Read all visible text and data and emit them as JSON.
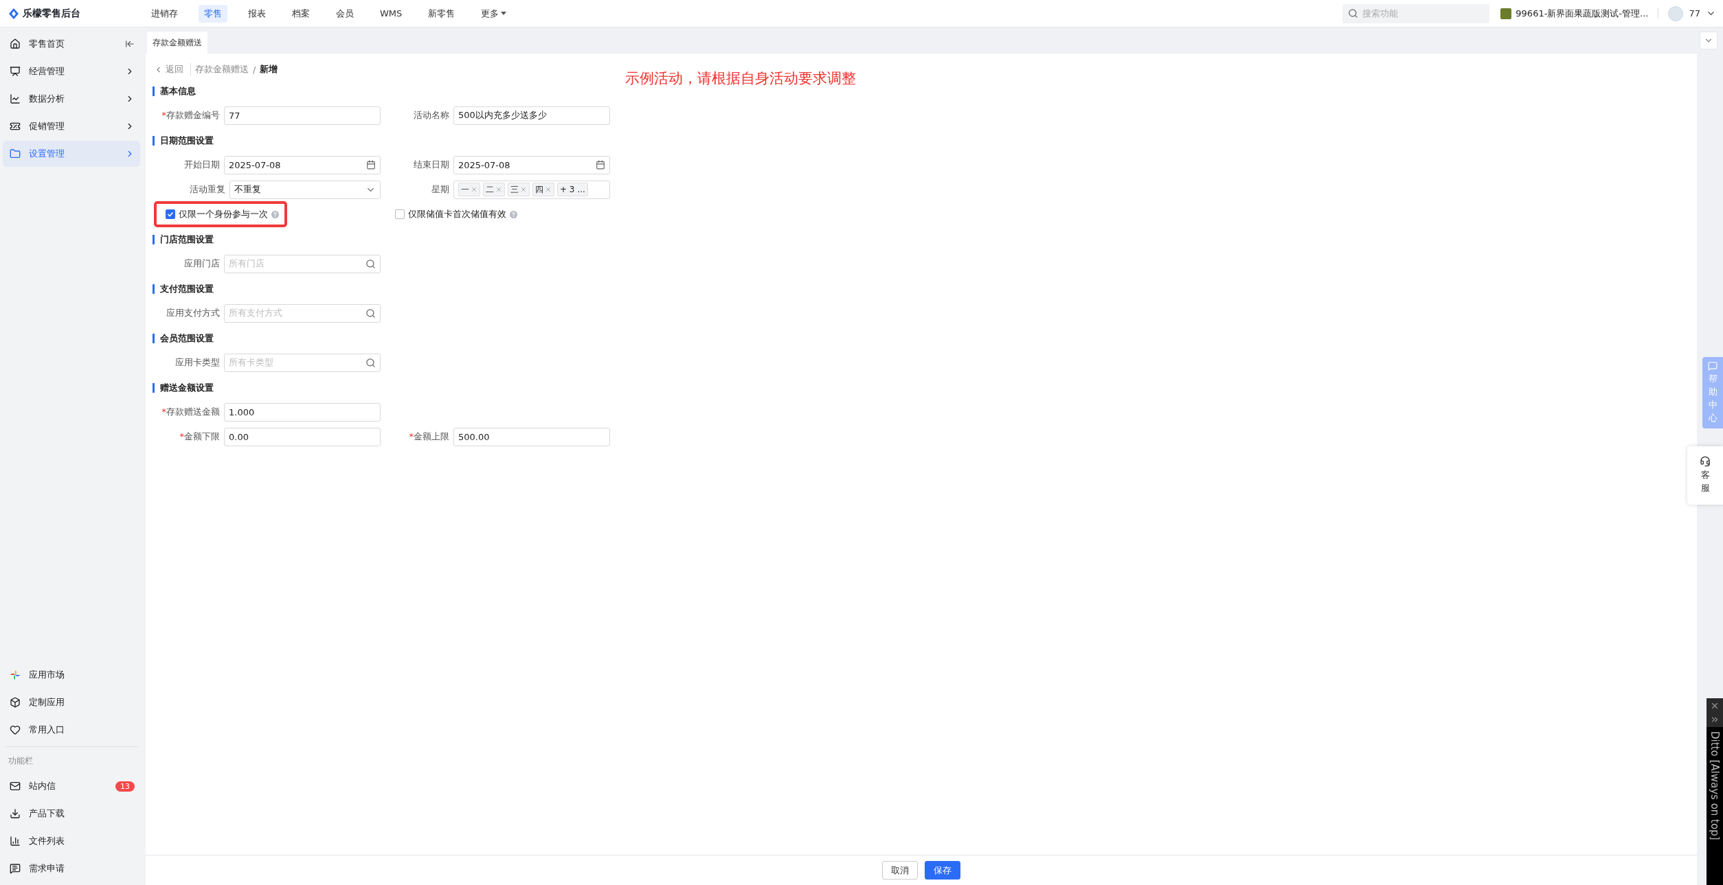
{
  "app": {
    "logo_text": "乐檬零售后台"
  },
  "top_nav": [
    {
      "label": "进销存",
      "selected": false,
      "kind": "link"
    },
    {
      "label": "零售",
      "selected": true,
      "kind": "link"
    },
    {
      "label": "报表",
      "selected": false,
      "kind": "link"
    },
    {
      "label": "档案",
      "selected": false,
      "kind": "link"
    },
    {
      "label": "会员",
      "selected": false,
      "kind": "link"
    },
    {
      "label": "WMS",
      "selected": false,
      "kind": "link"
    },
    {
      "label": "新零售",
      "selected": false,
      "kind": "link"
    },
    {
      "label": "更多",
      "selected": false,
      "kind": "dropdown"
    }
  ],
  "search": {
    "placeholder": "搜索功能"
  },
  "store": {
    "name": "99661-新界面果蔬版测试-管理..."
  },
  "user": {
    "name": "77"
  },
  "sidebar": {
    "items": [
      {
        "label": "零售首页",
        "selected": false
      },
      {
        "label": "经营管理",
        "selected": false
      },
      {
        "label": "数据分析",
        "selected": false
      },
      {
        "label": "促销管理",
        "selected": false
      },
      {
        "label": "设置管理",
        "selected": true
      }
    ],
    "bottom_items": [
      {
        "label": "应用市场"
      },
      {
        "label": "定制应用"
      },
      {
        "label": "常用入口"
      }
    ],
    "section_label": "功能栏",
    "tools": [
      {
        "label": "站内信",
        "badge": "13"
      },
      {
        "label": "产品下载"
      },
      {
        "label": "文件列表"
      },
      {
        "label": "需求申请"
      }
    ]
  },
  "tabs": [
    {
      "label": "存款金额赠送",
      "selected": true
    }
  ],
  "breadcrumb": {
    "back": "返回",
    "path": "存款金额赠送",
    "separator": "/",
    "current": "新增"
  },
  "annotation": "示例活动，请根据自身活动要求调整",
  "sections": [
    {
      "title": "基本信息",
      "rows": [
        [
          {
            "kind": "text",
            "required_mark": "*",
            "label": "存款赠金编号",
            "value": "77"
          },
          {
            "kind": "text",
            "label": "活动名称",
            "value": "500以内充多少送多少"
          }
        ]
      ]
    },
    {
      "title": "日期范围设置",
      "rows": [
        [
          {
            "kind": "date",
            "label": "开始日期",
            "value": "2025-07-08"
          },
          {
            "kind": "date",
            "label": "结束日期",
            "value": "2025-07-08"
          }
        ],
        [
          {
            "kind": "select",
            "label": "活动重复",
            "value": "不重复"
          },
          {
            "kind": "tags",
            "label": "星期",
            "tags": [
              "一",
              "二",
              "三",
              "四"
            ],
            "more": "+ 3 ..."
          }
        ],
        [
          {
            "kind": "checkbox",
            "label": "仅限一个身份参与一次",
            "checked": true,
            "highlighted": true
          },
          {
            "kind": "checkbox",
            "label": "仅限储值卡首次储值有效",
            "checked": false,
            "highlighted": false
          }
        ]
      ]
    },
    {
      "title": "门店范围设置",
      "rows": [
        [
          {
            "kind": "search",
            "label": "应用门店",
            "placeholder": "所有门店"
          }
        ]
      ]
    },
    {
      "title": "支付范围设置",
      "rows": [
        [
          {
            "kind": "search",
            "label": "应用支付方式",
            "placeholder": "所有支付方式"
          }
        ]
      ]
    },
    {
      "title": "会员范围设置",
      "rows": [
        [
          {
            "kind": "search",
            "label": "应用卡类型",
            "placeholder": "所有卡类型"
          }
        ]
      ]
    },
    {
      "title": "赠送金额设置",
      "rows": [
        [
          {
            "kind": "text",
            "required_mark": "*",
            "label": "存款赠送金额",
            "value": "1.000"
          }
        ],
        [
          {
            "kind": "text",
            "required_mark": "*",
            "label": "金额下限",
            "value": "0.00"
          },
          {
            "kind": "text",
            "required_mark": "*",
            "label": "金额上限",
            "value": "500.00"
          }
        ]
      ]
    }
  ],
  "footer_buttons": [
    {
      "label": "取消",
      "kind": "default"
    },
    {
      "label": "保存",
      "kind": "primary"
    }
  ],
  "side_widgets": [
    {
      "label": "帮助中心",
      "kind": "help"
    },
    {
      "label": "客服",
      "kind": "service"
    }
  ],
  "ditto": {
    "title": "Ditto [Always on top]"
  }
}
